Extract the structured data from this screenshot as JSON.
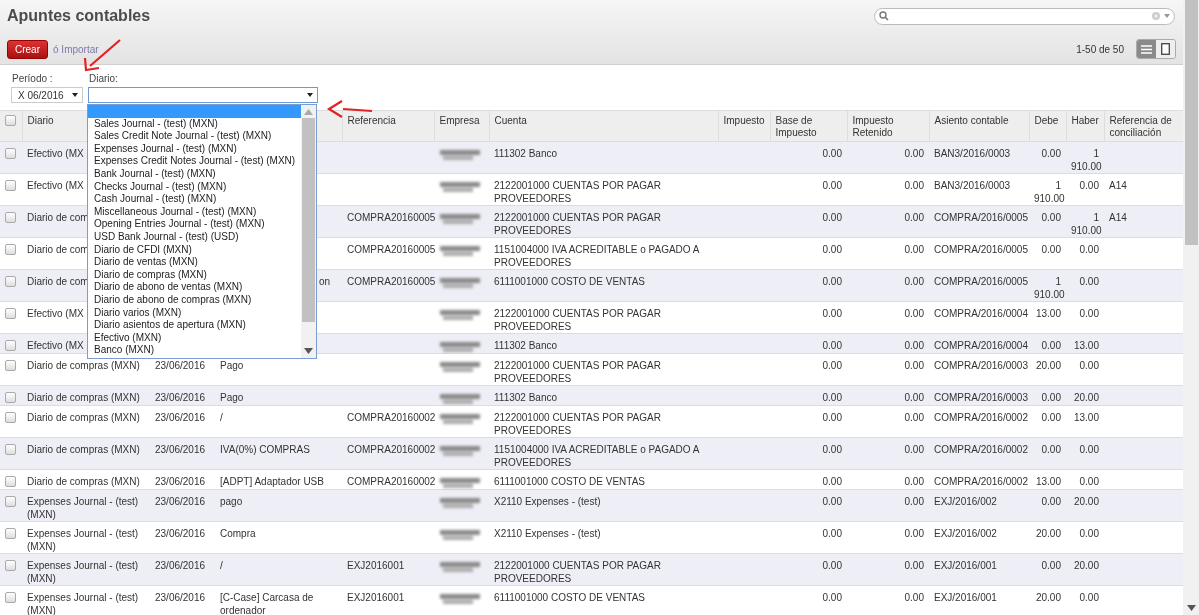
{
  "title": "Apuntes contables",
  "create_button": "Crear",
  "import_link": "ó Importar",
  "pager": "1-50 de 50",
  "view_switch": [
    {
      "kind": "list",
      "selected": true
    },
    {
      "kind": "form",
      "selected": false
    }
  ],
  "filters": {
    "period_label": "Período :",
    "period_value": "X 06/2016",
    "journal_label": "Diario:"
  },
  "journal_dropdown": {
    "blank_option": {
      "selected": true
    },
    "options": [
      {
        "label": "Sales Journal - (test) (MXN)",
        "selected": false
      },
      {
        "label": "Sales Credit Note Journal - (test) (MXN)",
        "selected": false
      },
      {
        "label": "Expenses Journal - (test) (MXN)",
        "selected": false
      },
      {
        "label": "Expenses Credit Notes Journal - (test) (MXN)",
        "selected": false
      },
      {
        "label": "Bank Journal - (test) (MXN)",
        "selected": false
      },
      {
        "label": "Checks Journal - (test) (MXN)",
        "selected": false
      },
      {
        "label": "Cash Journal - (test) (MXN)",
        "selected": false
      },
      {
        "label": "Miscellaneous Journal - (test) (MXN)",
        "selected": false
      },
      {
        "label": "Opening Entries Journal - (test) (MXN)",
        "selected": false
      },
      {
        "label": "USD Bank Journal - (test) (USD)",
        "selected": false
      },
      {
        "label": "Diario de CFDI (MXN)",
        "selected": false
      },
      {
        "label": "Diario de ventas (MXN)",
        "selected": false
      },
      {
        "label": "Diario de compras (MXN)",
        "selected": false
      },
      {
        "label": "Diario de abono de ventas (MXN)",
        "selected": false
      },
      {
        "label": "Diario de abono de compras (MXN)",
        "selected": false
      },
      {
        "label": "Diario varios (MXN)",
        "selected": false
      },
      {
        "label": "Diario asientos de apertura (MXN)",
        "selected": false
      },
      {
        "label": "Efectivo (MXN)",
        "selected": false
      },
      {
        "label": "Banco (MXN)",
        "selected": false
      }
    ]
  },
  "table": {
    "select_all": {
      "checked": false
    },
    "columns": [
      "Diario",
      "",
      "",
      "Referencia",
      "Empresa",
      "Cuenta",
      "Impuesto",
      "Base de Impuesto",
      "Impuesto Retenido",
      "Asiento contable",
      "Debe",
      "Haber",
      "Referencia de conciliación"
    ],
    "rows": [
      {
        "checked": false,
        "diario": "Efectivo (MX",
        "fecha": "",
        "nombre": "",
        "referencia": "",
        "empresa_redacted": true,
        "cuenta": "111302 Banco",
        "base": "0.00",
        "retenido": "0.00",
        "asiento": "BAN3/2016/0003",
        "debe": "0.00",
        "haber": "1 910.00",
        "conciliacion": ""
      },
      {
        "checked": false,
        "diario": "Efectivo (MX",
        "fecha": "",
        "nombre": "",
        "referencia": "",
        "empresa_redacted": true,
        "cuenta": "2122001000 CUENTAS POR PAGAR PROVEEDORES",
        "base": "0.00",
        "retenido": "0.00",
        "asiento": "BAN3/2016/0003",
        "debe": "1 910.00",
        "haber": "0.00",
        "conciliacion": "A14"
      },
      {
        "checked": false,
        "diario": "Diario de com",
        "fecha": "",
        "nombre": "",
        "referencia": "COMPRA20160005",
        "empresa_redacted": true,
        "cuenta": "2122001000 CUENTAS POR PAGAR PROVEEDORES",
        "base": "0.00",
        "retenido": "0.00",
        "asiento": "COMPRA/2016/0005",
        "debe": "0.00",
        "haber": "1 910.00",
        "conciliacion": "A14"
      },
      {
        "checked": false,
        "diario": "Diario de com",
        "fecha": "",
        "nombre": "",
        "referencia": "COMPRA20160005",
        "empresa_redacted": true,
        "cuenta": "1151004000 IVA ACREDITABLE o PAGADO A PROVEEDORES",
        "base": "0.00",
        "retenido": "0.00",
        "asiento": "COMPRA/2016/0005",
        "debe": "0.00",
        "haber": "0.00",
        "conciliacion": ""
      },
      {
        "checked": false,
        "diario": "Diario de com",
        "fecha": "",
        "nombre": "on",
        "nombre_cut_start": true,
        "referencia": "COMPRA20160005",
        "empresa_redacted": true,
        "cuenta": "6111001000 COSTO DE VENTAS",
        "base": "0.00",
        "retenido": "0.00",
        "asiento": "COMPRA/2016/0005",
        "debe": "1 910.00",
        "haber": "0.00",
        "conciliacion": ""
      },
      {
        "checked": false,
        "diario": "Efectivo (MX",
        "fecha": "",
        "nombre": "",
        "referencia": "",
        "empresa_redacted": true,
        "cuenta": "2122001000 CUENTAS POR PAGAR PROVEEDORES",
        "base": "0.00",
        "retenido": "0.00",
        "asiento": "COMPRA/2016/0004",
        "debe": "13.00",
        "haber": "0.00",
        "conciliacion": ""
      },
      {
        "checked": false,
        "diario": "Efectivo (MX",
        "fecha": "",
        "nombre": "",
        "referencia": "",
        "empresa_redacted": true,
        "cuenta": "111302 Banco",
        "base": "0.00",
        "retenido": "0.00",
        "asiento": "COMPRA/2016/0004",
        "debe": "0.00",
        "haber": "13.00",
        "conciliacion": ""
      },
      {
        "checked": false,
        "diario": "Diario de compras (MXN)",
        "fecha": "23/06/2016",
        "nombre": "Pago",
        "referencia": "",
        "empresa_redacted": true,
        "cuenta": "2122001000 CUENTAS POR PAGAR PROVEEDORES",
        "base": "0.00",
        "retenido": "0.00",
        "asiento": "COMPRA/2016/0003",
        "debe": "20.00",
        "haber": "0.00",
        "conciliacion": ""
      },
      {
        "checked": false,
        "diario": "Diario de compras (MXN)",
        "fecha": "23/06/2016",
        "nombre": "Pago",
        "referencia": "",
        "empresa_redacted": true,
        "cuenta": "111302 Banco",
        "base": "0.00",
        "retenido": "0.00",
        "asiento": "COMPRA/2016/0003",
        "debe": "0.00",
        "haber": "20.00",
        "conciliacion": ""
      },
      {
        "checked": false,
        "diario": "Diario de compras (MXN)",
        "fecha": "23/06/2016",
        "nombre": "/",
        "referencia": "COMPRA20160002",
        "empresa_redacted": true,
        "cuenta": "2122001000 CUENTAS POR PAGAR PROVEEDORES",
        "base": "0.00",
        "retenido": "0.00",
        "asiento": "COMPRA/2016/0002",
        "debe": "0.00",
        "haber": "13.00",
        "conciliacion": ""
      },
      {
        "checked": false,
        "diario": "Diario de compras (MXN)",
        "fecha": "23/06/2016",
        "nombre": "IVA(0%) COMPRAS",
        "referencia": "COMPRA20160002",
        "empresa_redacted": true,
        "cuenta": "1151004000 IVA ACREDITABLE o PAGADO A PROVEEDORES",
        "base": "0.00",
        "retenido": "0.00",
        "asiento": "COMPRA/2016/0002",
        "debe": "0.00",
        "haber": "0.00",
        "conciliacion": ""
      },
      {
        "checked": false,
        "diario": "Diario de compras (MXN)",
        "fecha": "23/06/2016",
        "nombre": "[ADPT] Adaptador USB",
        "referencia": "COMPRA20160002",
        "empresa_redacted": true,
        "cuenta": "6111001000 COSTO DE VENTAS",
        "base": "0.00",
        "retenido": "0.00",
        "asiento": "COMPRA/2016/0002",
        "debe": "13.00",
        "haber": "0.00",
        "conciliacion": ""
      },
      {
        "checked": false,
        "diario": "Expenses Journal - (test) (MXN)",
        "fecha": "23/06/2016",
        "nombre": "pago",
        "referencia": "",
        "empresa_redacted": true,
        "cuenta": "X2110 Expenses - (test)",
        "base": "0.00",
        "retenido": "0.00",
        "asiento": "EXJ/2016/002",
        "debe": "0.00",
        "haber": "20.00",
        "conciliacion": ""
      },
      {
        "checked": false,
        "diario": "Expenses Journal - (test) (MXN)",
        "fecha": "23/06/2016",
        "nombre": "Compra",
        "referencia": "",
        "empresa_redacted": true,
        "cuenta": "X2110 Expenses - (test)",
        "base": "0.00",
        "retenido": "0.00",
        "asiento": "EXJ/2016/002",
        "debe": "20.00",
        "haber": "0.00",
        "conciliacion": ""
      },
      {
        "checked": false,
        "diario": "Expenses Journal - (test) (MXN)",
        "fecha": "23/06/2016",
        "nombre": "/",
        "referencia": "EXJ2016001",
        "empresa_redacted": true,
        "cuenta": "2122001000 CUENTAS POR PAGAR PROVEEDORES",
        "base": "0.00",
        "retenido": "0.00",
        "asiento": "EXJ/2016/001",
        "debe": "0.00",
        "haber": "20.00",
        "conciliacion": ""
      },
      {
        "checked": false,
        "diario": "Expenses Journal - (test) (MXN)",
        "fecha": "23/06/2016",
        "nombre": "[C-Case] Carcasa de ordenador",
        "referencia": "EXJ2016001",
        "empresa_redacted": true,
        "cuenta": "6111001000 COSTO DE VENTAS",
        "base": "0.00",
        "retenido": "0.00",
        "asiento": "EXJ/2016/001",
        "debe": "20.00",
        "haber": "0.00",
        "conciliacion": ""
      }
    ]
  }
}
